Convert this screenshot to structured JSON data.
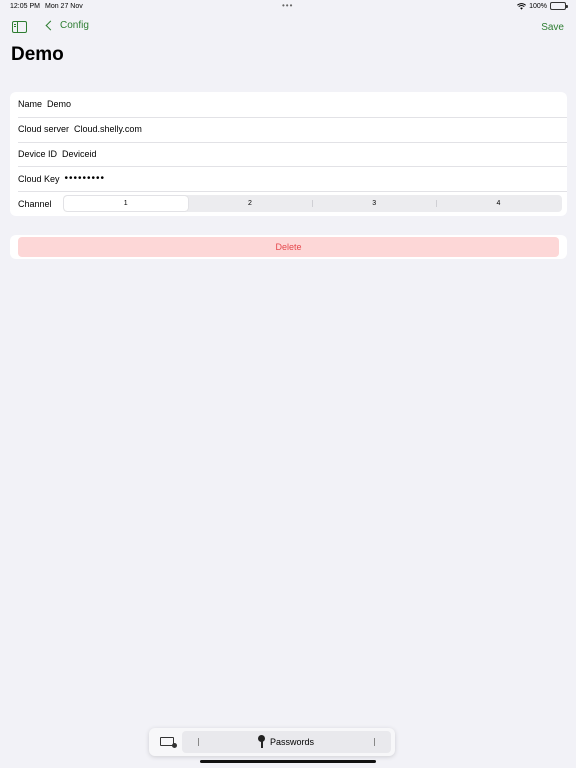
{
  "status_bar": {
    "time": "12:05 PM",
    "date": "Mon 27 Nov",
    "multitask_dots": "•••",
    "battery": "100%",
    "icons": [
      "wifi-icon",
      "battery-icon"
    ]
  },
  "nav": {
    "sidebar_icon": "sidebar-toggle-icon",
    "back_label": "Config",
    "save_label": "Save",
    "accent_color": "#2e7d32"
  },
  "page": {
    "title": "Demo"
  },
  "form": {
    "name": {
      "label": "Name",
      "value": "Demo"
    },
    "cloud_server": {
      "label": "Cloud server",
      "value": "Cloud.shelly.com"
    },
    "device_id": {
      "label": "Device ID",
      "value": "Deviceid"
    },
    "cloud_key": {
      "label": "Cloud Key",
      "value": "•••••••••"
    },
    "channel": {
      "label": "Channel",
      "options": [
        "1",
        "2",
        "3",
        "4"
      ],
      "selected": "1"
    }
  },
  "delete": {
    "label": "Delete",
    "color": "#e5484d"
  },
  "keyboard_bar": {
    "keyboard_icon": "keyboard-icon",
    "key_icon": "key-icon",
    "passwords_label": "Passwords"
  }
}
